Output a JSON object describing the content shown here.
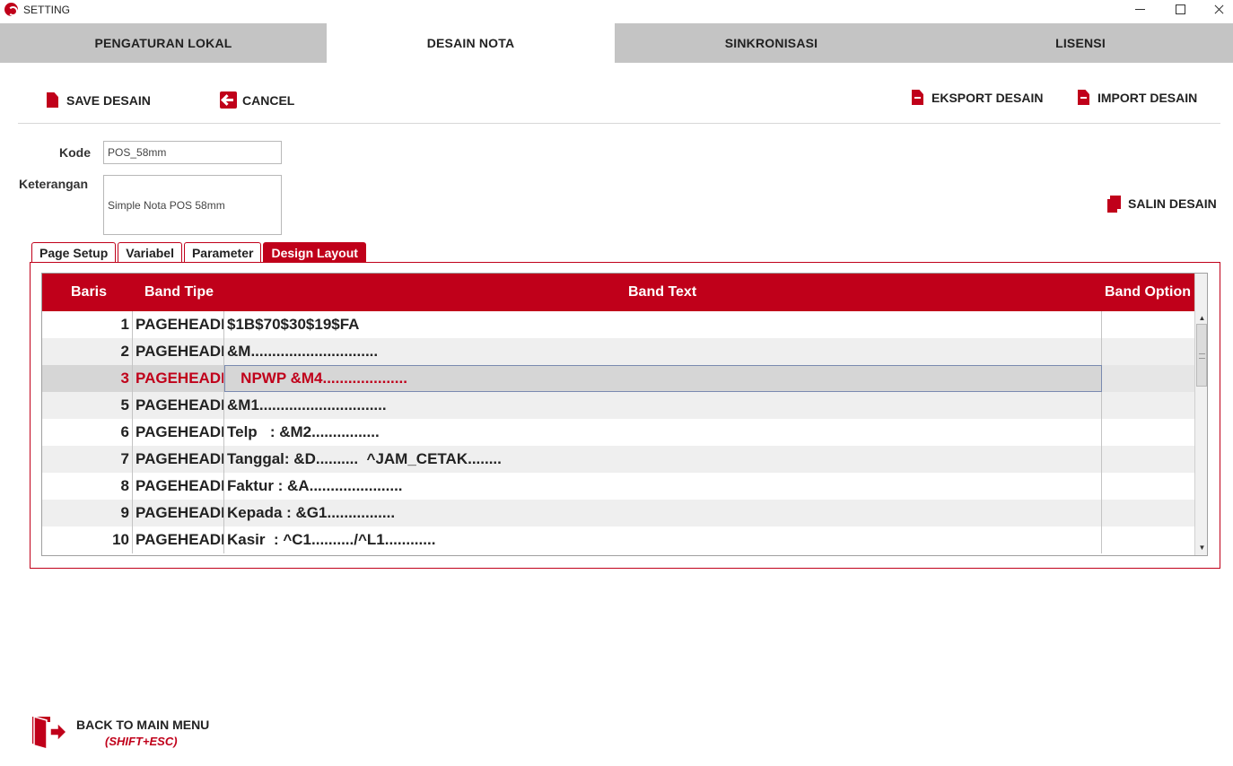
{
  "window": {
    "title": "SETTING"
  },
  "main_tabs": [
    {
      "label": "PENGATURAN LOKAL"
    },
    {
      "label": "DESAIN NOTA"
    },
    {
      "label": "SINKRONISASI"
    },
    {
      "label": "LISENSI"
    }
  ],
  "toolbar": {
    "save_label": "SAVE DESAIN",
    "cancel_label": "CANCEL",
    "export_label": "EKSPORT DESAIN",
    "import_label": "IMPORT DESAIN",
    "copy_label": "SALIN DESAIN"
  },
  "form": {
    "kode_label": "Kode",
    "kode_value": "POS_58mm",
    "keterangan_label": "Keterangan",
    "keterangan_value": "Simple Nota POS 58mm"
  },
  "sub_tabs": [
    {
      "label": "Page Setup"
    },
    {
      "label": "Variabel"
    },
    {
      "label": "Parameter"
    },
    {
      "label": "Design Layout"
    }
  ],
  "grid": {
    "columns": [
      "Baris",
      "Band Tipe",
      "Band Text",
      "Band Option"
    ],
    "rows": [
      {
        "baris": "1",
        "tipe": "PAGEHEADER",
        "text": "$1B$70$30$19$FA",
        "option": ""
      },
      {
        "baris": "2",
        "tipe": "PAGEHEADER",
        "text": "&M..............................",
        "option": ""
      },
      {
        "baris": "3",
        "tipe": "PAGEHEADER",
        "text": "   NPWP &M4....................",
        "option": ""
      },
      {
        "baris": "5",
        "tipe": "PAGEHEADER",
        "text": "&M1..............................",
        "option": ""
      },
      {
        "baris": "6",
        "tipe": "PAGEHEADER",
        "text": "Telp   : &M2................",
        "option": ""
      },
      {
        "baris": "7",
        "tipe": "PAGEHEADER",
        "text": "Tanggal: &D..........  ^JAM_CETAK........",
        "option": ""
      },
      {
        "baris": "8",
        "tipe": "PAGEHEADER",
        "text": "Faktur : &A......................",
        "option": ""
      },
      {
        "baris": "9",
        "tipe": "PAGEHEADER",
        "text": "Kepada : &G1................",
        "option": ""
      },
      {
        "baris": "10",
        "tipe": "PAGEHEADER",
        "text": "Kasir  : ^C1........../^L1............",
        "option": ""
      }
    ]
  },
  "back": {
    "label": "BACK TO MAIN MENU",
    "shortcut": "(SHIFT+ESC)"
  },
  "colors": {
    "accent": "#c0001a",
    "tab_inactive": "#c4c4c4",
    "row_alt": "#efefef",
    "row_selected": "#d6d6d6"
  }
}
